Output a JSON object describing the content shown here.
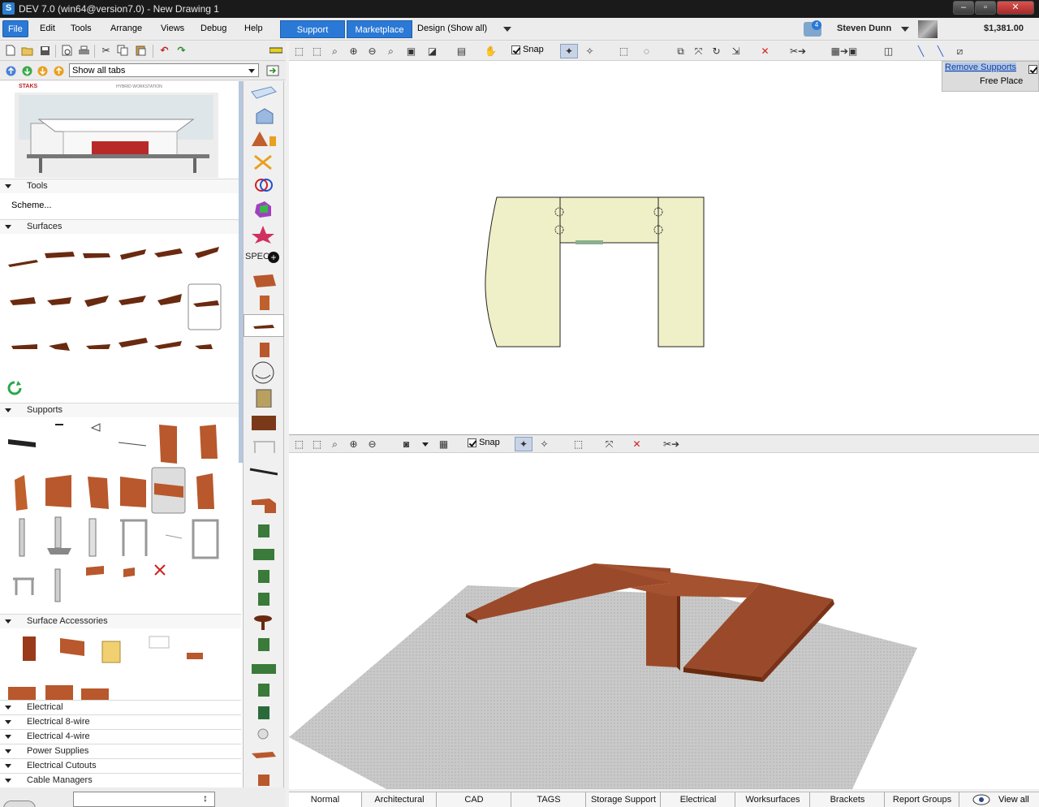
{
  "titlebar": {
    "title": "DEV 7.0 (win64@version7.0) - New Drawing 1",
    "app_icon": "S"
  },
  "menu": {
    "items": [
      "File",
      "Edit",
      "Tools",
      "Arrange",
      "Views",
      "Debug",
      "Help"
    ],
    "active": "File"
  },
  "header": {
    "support_label": "Support",
    "marketplace_label": "Marketplace",
    "design_label": "Design (Show all)",
    "notification_count": "4",
    "user_name": "Steven Dunn",
    "balance": "$1,381.00"
  },
  "toolbar2": {
    "tabs_select": "Show all tabs",
    "snap_label": "Snap"
  },
  "preview": {
    "brand": "STAKS",
    "caption": "HYBRID WORKSTATION"
  },
  "left_sections": {
    "tools": "Tools",
    "scheme": "Scheme...",
    "surfaces": "Surfaces",
    "supports": "Supports",
    "surface_accessories": "Surface Accessories",
    "categories": [
      "Electrical",
      "Electrical 8-wire",
      "Electrical 4-wire",
      "Power Supplies",
      "Electrical Cutouts",
      "Cable Managers"
    ]
  },
  "iconstrip": {
    "spec_label": "SPEC"
  },
  "view2d": {
    "remove_supports_label": "Remove Supports",
    "remove_supports_checked": true,
    "free_place_label": "Free Place",
    "free_place_checked": false
  },
  "view3d": {
    "snap_label": "Snap"
  },
  "bottom_tabs": [
    "Normal",
    "Architectural",
    "CAD",
    "TAGS",
    "Storage Support",
    "Electrical",
    "Worksurfaces",
    "Brackets",
    "Report Groups"
  ],
  "view_all_label": "View all",
  "colors": {
    "accent": "#2b79d6",
    "wood": "#9a4a2a",
    "plan_fill": "#f0f0c8"
  }
}
